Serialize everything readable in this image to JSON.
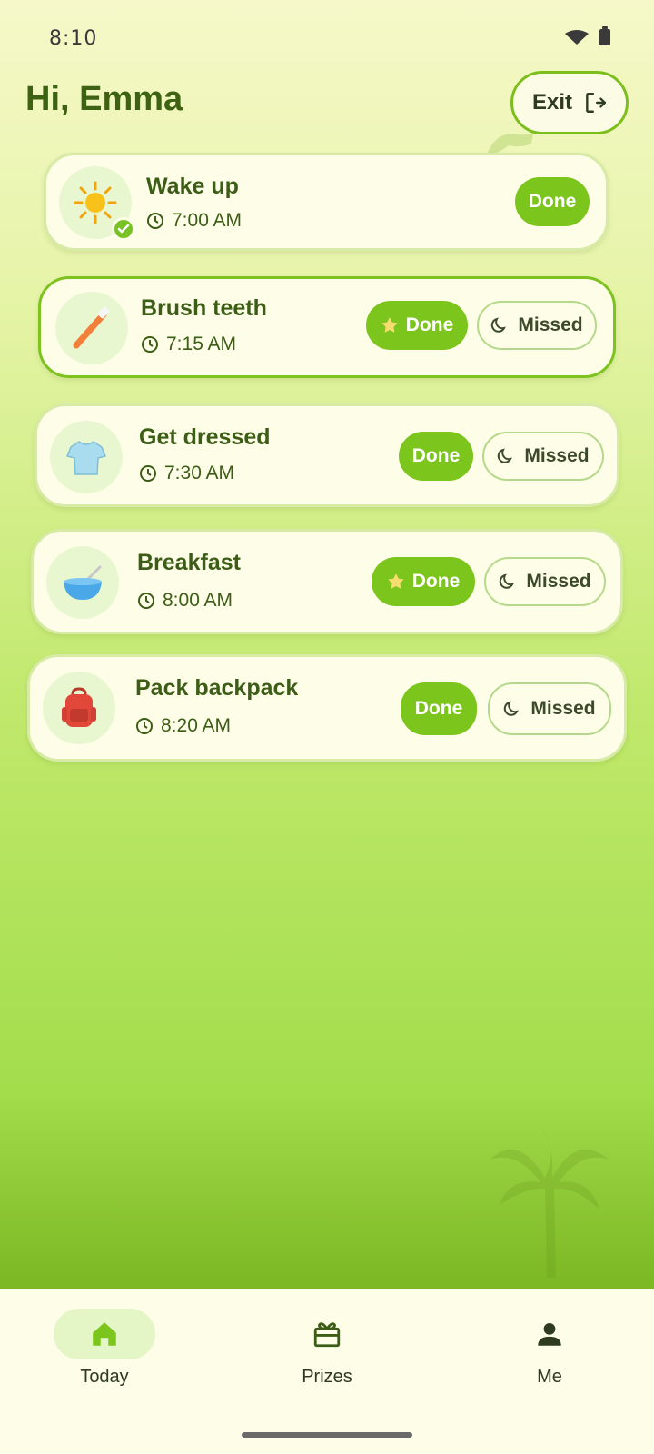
{
  "status_bar": {
    "time": "8:10"
  },
  "header": {
    "greeting": "Hi, Emma",
    "exit_label": "Exit"
  },
  "tasks": [
    {
      "title": "Wake up",
      "time": "7:00 AM",
      "icon": "sun-icon",
      "done_label": "Done",
      "completed": true
    },
    {
      "title": "Brush teeth",
      "time": "7:15 AM",
      "icon": "toothbrush-icon",
      "done_label": "Done",
      "missed_label": "Missed",
      "starred": true
    },
    {
      "title": "Get dressed",
      "time": "7:30 AM",
      "icon": "tshirt-icon",
      "done_label": "Done",
      "missed_label": "Missed"
    },
    {
      "title": "Breakfast",
      "time": "8:00 AM",
      "icon": "bowl-icon",
      "done_label": "Done",
      "missed_label": "Missed",
      "starred": true
    },
    {
      "title": "Pack backpack",
      "time": "8:20 AM",
      "icon": "backpack-icon",
      "done_label": "Done",
      "missed_label": "Missed"
    }
  ],
  "nav": {
    "items": [
      {
        "label": "Today",
        "icon": "home-icon",
        "active": true
      },
      {
        "label": "Prizes",
        "icon": "gift-icon"
      },
      {
        "label": "Me",
        "icon": "person-icon"
      }
    ]
  },
  "colors": {
    "accent": "#7cc51c",
    "text_dark_green": "#3c5d15",
    "card_bg": "#fdfde8"
  }
}
